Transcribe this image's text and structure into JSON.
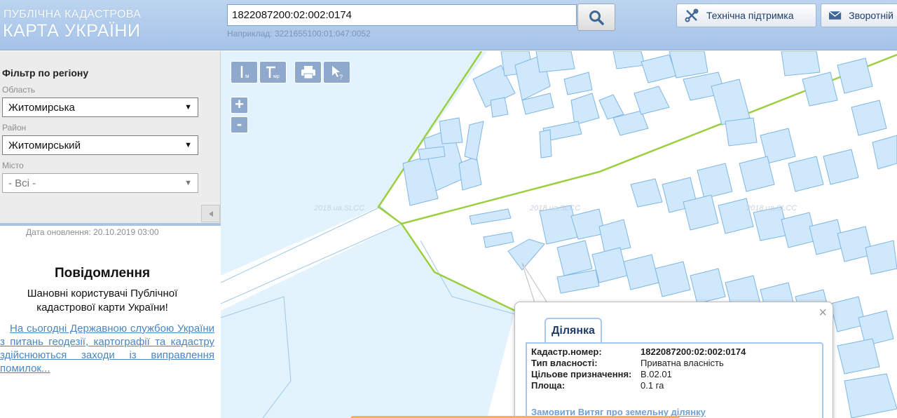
{
  "header": {
    "logo_line1": "ПУБЛІЧНА КАДАСТРОВА",
    "logo_line2": "КАРТА УКРАЇНИ",
    "search_value": "1822087200:02:002:0174",
    "search_hint": "Наприклад: 3221655100:01:047:0052",
    "support_label": "Технічна підтримка",
    "feedback_label": "Зворотній",
    "search_icon": "magnifier-icon",
    "support_icon": "tools-icon",
    "feedback_icon": "envelope-icon"
  },
  "filter": {
    "title": "Фільтр по регіону",
    "oblast_label": "Область",
    "oblast_value": "Житомирська",
    "raion_label": "Район",
    "raion_value": "Житомирський",
    "misto_label": "Місто",
    "misto_value": "- Всі -",
    "select_arrow": "▼"
  },
  "notice": {
    "update_date": "Дата оновлення: 20.10.2019 03:00",
    "title": "Повідомлення",
    "text": "Шановні користувачі Публічної кадастрової карти України!",
    "link": "На сьогодні Державною службою України з питань геодезії, картографії та кадастру здійснюються заходи із виправлення помилок..."
  },
  "map": {
    "zoom_in": "+",
    "zoom_out": "-",
    "watermark": "2018.ua.SLCC",
    "tools": [
      "measure-length-icon",
      "measure-area-icon",
      "print-icon",
      "identify-icon"
    ],
    "colors": {
      "parcel_fill": "#cfe8fb",
      "parcel_stroke": "#7fb6e6",
      "boundary": "#9ccf3f",
      "water": "#e3f3fd"
    }
  },
  "popup": {
    "tab_label": "Ділянка",
    "close": "×",
    "rows": [
      {
        "key": "Кадастр.номер:",
        "value": "1822087200:02:002:0174"
      },
      {
        "key": "Тип власності:",
        "value": "Приватна власність"
      },
      {
        "key": "Цільове призначення:",
        "value": "B.02.01"
      },
      {
        "key": "Площа:",
        "value": "0.1 га"
      }
    ],
    "order_link": "Замовити Витяг про земельну ділянку"
  }
}
